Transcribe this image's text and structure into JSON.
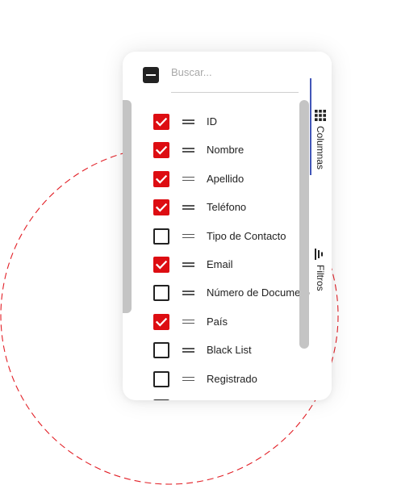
{
  "search": {
    "placeholder": "Buscar..."
  },
  "columns": [
    {
      "label": "ID",
      "checked": true
    },
    {
      "label": "Nombre",
      "checked": true
    },
    {
      "label": "Apellido",
      "checked": true
    },
    {
      "label": "Teléfono",
      "checked": true
    },
    {
      "label": "Tipo de Contacto",
      "checked": false
    },
    {
      "label": "Email",
      "checked": true
    },
    {
      "label": "Número de Documento",
      "checked": false
    },
    {
      "label": "País",
      "checked": true
    },
    {
      "label": "Black List",
      "checked": false
    },
    {
      "label": "Registrado",
      "checked": false
    }
  ],
  "side_tabs": [
    {
      "label": "Columnas",
      "icon": "grid-icon",
      "active": true
    },
    {
      "label": "Filtros",
      "icon": "filter-icon",
      "active": false
    }
  ],
  "colors": {
    "accent_checked": "#dd0d12",
    "active_tab": "#4256b8",
    "decor_circle": "#e21f26"
  }
}
